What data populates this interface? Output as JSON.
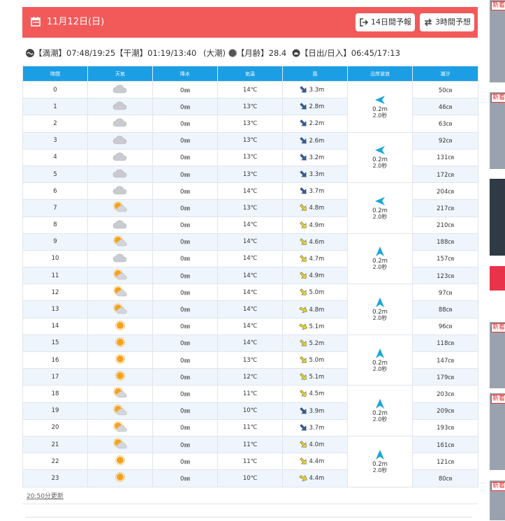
{
  "header": {
    "date": "11月12日(日)",
    "btn14": "14日間予報",
    "btn3": "3時間予想"
  },
  "tide_info": {
    "high_label": "【満潮】",
    "high": "07:48/19:25",
    "low_label": "【干潮】",
    "low": "01:19/13:40",
    "tide_type": "(大潮)",
    "moon_label": "【月齢】",
    "moon": "28.4",
    "sun_label": "【日出/日入】",
    "sun": "06:45/17:13"
  },
  "table": {
    "headers": [
      "時間",
      "天気",
      "降水",
      "気温",
      "風",
      "沿岸波浪",
      "潮汐"
    ],
    "rows": [
      {
        "hour": "0",
        "weather": "cloudy",
        "rain": "0㎜",
        "temp": "14℃",
        "wind_dir": "SE",
        "wind": "3.3m",
        "tide": "50㎝"
      },
      {
        "hour": "1",
        "weather": "cloudy",
        "rain": "0㎜",
        "temp": "13℃",
        "wind_dir": "SE",
        "wind": "2.8m",
        "tide": "46㎝"
      },
      {
        "hour": "2",
        "weather": "cloudy",
        "rain": "0㎜",
        "temp": "13℃",
        "wind_dir": "SE",
        "wind": "2.2m",
        "tide": "63㎝"
      },
      {
        "hour": "3",
        "weather": "cloudy",
        "rain": "0㎜",
        "temp": "13℃",
        "wind_dir": "SE",
        "wind": "2.6m",
        "tide": "92㎝"
      },
      {
        "hour": "4",
        "weather": "cloudy",
        "rain": "0㎜",
        "temp": "13℃",
        "wind_dir": "SE",
        "wind": "3.2m",
        "tide": "131㎝"
      },
      {
        "hour": "5",
        "weather": "cloudy",
        "rain": "0㎜",
        "temp": "13℃",
        "wind_dir": "SE",
        "wind": "3.3m",
        "tide": "172㎝"
      },
      {
        "hour": "6",
        "weather": "cloudy",
        "rain": "0㎜",
        "temp": "14℃",
        "wind_dir": "SE",
        "wind": "3.7m",
        "tide": "204㎝"
      },
      {
        "hour": "7",
        "weather": "sun-cloud",
        "rain": "0㎜",
        "temp": "13℃",
        "wind_dir": "SE-Y",
        "wind": "4.8m",
        "tide": "217㎝"
      },
      {
        "hour": "8",
        "weather": "cloudy",
        "rain": "0㎜",
        "temp": "14℃",
        "wind_dir": "SE-Y",
        "wind": "4.9m",
        "tide": "210㎝"
      },
      {
        "hour": "9",
        "weather": "sun-cloud",
        "rain": "0㎜",
        "temp": "14℃",
        "wind_dir": "SE-Y",
        "wind": "4.6m",
        "tide": "188㎝"
      },
      {
        "hour": "10",
        "weather": "cloudy",
        "rain": "0㎜",
        "temp": "14℃",
        "wind_dir": "SE-Y",
        "wind": "4.7m",
        "tide": "157㎝"
      },
      {
        "hour": "11",
        "weather": "sun-cloud",
        "rain": "0㎜",
        "temp": "14℃",
        "wind_dir": "SE-Y",
        "wind": "4.9m",
        "tide": "123㎝"
      },
      {
        "hour": "12",
        "weather": "sun-cloud",
        "rain": "0㎜",
        "temp": "14℃",
        "wind_dir": "SE-Y",
        "wind": "5.0m",
        "tide": "97㎝"
      },
      {
        "hour": "13",
        "weather": "sun-cloud",
        "rain": "0㎜",
        "temp": "14℃",
        "wind_dir": "E-Y",
        "wind": "4.8m",
        "tide": "88㎝"
      },
      {
        "hour": "14",
        "weather": "sunny",
        "rain": "0㎜",
        "temp": "14℃",
        "wind_dir": "E-Y",
        "wind": "5.1m",
        "tide": "96㎝"
      },
      {
        "hour": "15",
        "weather": "sunny",
        "rain": "0㎜",
        "temp": "14℃",
        "wind_dir": "SE-Y",
        "wind": "5.2m",
        "tide": "118㎝"
      },
      {
        "hour": "16",
        "weather": "sunny",
        "rain": "0㎜",
        "temp": "13℃",
        "wind_dir": "SE-Y",
        "wind": "5.0m",
        "tide": "147㎝"
      },
      {
        "hour": "17",
        "weather": "sunny",
        "rain": "0㎜",
        "temp": "12℃",
        "wind_dir": "SE-Y",
        "wind": "5.1m",
        "tide": "179㎝"
      },
      {
        "hour": "18",
        "weather": "sun-cloud",
        "rain": "0㎜",
        "temp": "11℃",
        "wind_dir": "SE-Y",
        "wind": "4.5m",
        "tide": "203㎝"
      },
      {
        "hour": "19",
        "weather": "sun-cloud",
        "rain": "0㎜",
        "temp": "10℃",
        "wind_dir": "SE",
        "wind": "3.9m",
        "tide": "209㎝"
      },
      {
        "hour": "20",
        "weather": "sun-cloud",
        "rain": "0㎜",
        "temp": "11℃",
        "wind_dir": "SE",
        "wind": "3.7m",
        "tide": "193㎝"
      },
      {
        "hour": "21",
        "weather": "sun-cloud",
        "rain": "0㎜",
        "temp": "11℃",
        "wind_dir": "SE-Y",
        "wind": "4.0m",
        "tide": "161㎝"
      },
      {
        "hour": "22",
        "weather": "sunny",
        "rain": "0㎜",
        "temp": "11℃",
        "wind_dir": "SE-Y",
        "wind": "4.4m",
        "tide": "121㎝"
      },
      {
        "hour": "23",
        "weather": "sunny",
        "rain": "0㎜",
        "temp": "10℃",
        "wind_dir": "E-Y",
        "wind": "4.4m",
        "tide": "80㎝"
      }
    ],
    "waves": [
      {
        "dir": "W",
        "height": "0.2m",
        "period": "2.0秒"
      },
      {
        "dir": "W",
        "height": "0.2m",
        "period": "2.0秒"
      },
      {
        "dir": "W",
        "height": "0.2m",
        "period": "2.0秒"
      },
      {
        "dir": "N",
        "height": "0.2m",
        "period": "2.0秒"
      },
      {
        "dir": "N",
        "height": "0.2m",
        "period": "2.0秒"
      },
      {
        "dir": "N",
        "height": "0.2m",
        "period": "2.0秒"
      },
      {
        "dir": "N",
        "height": "0.2m",
        "period": "2.0秒"
      },
      {
        "dir": "N",
        "height": "0.2m",
        "period": "2.0秒"
      }
    ]
  },
  "updated": "20:50分更新",
  "sidebar": {
    "new_label": "新着"
  },
  "colors": {
    "header": "#f25a5a",
    "table_head": "#1c9ee4",
    "alt_row": "#eef5fc",
    "wave_arrow": "#1aa7d8"
  }
}
